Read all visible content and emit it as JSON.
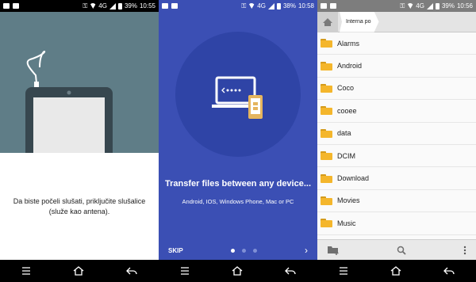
{
  "panels": [
    {
      "status": {
        "time": "10:55",
        "battery": "39%",
        "network": "4G"
      },
      "message": "Da biste počeli slušati, priključite slušalice (služe kao antena)."
    },
    {
      "status": {
        "time": "10:58",
        "battery": "38%",
        "network": "4G"
      },
      "title": "Transfer files between any device...",
      "subtitle": "Android, IOS, Windows Phone, Mac or PC",
      "skip_label": "SKIP",
      "page_indicator": {
        "pages": 3,
        "current": 1
      }
    },
    {
      "status": {
        "time": "10:56",
        "battery": "39%",
        "network": "4G"
      },
      "breadcrumb": "Interna po",
      "folders": [
        "Alarms",
        "Android",
        "Coco",
        "cooee",
        "data",
        "DCIM",
        "Download",
        "Movies",
        "Music"
      ]
    }
  ],
  "icons": {
    "home": "home-icon",
    "back": "back-arrow-icon",
    "menu": "menu-lines-icon",
    "new_folder": "new-folder-icon",
    "search": "search-icon",
    "overflow": "overflow-menu-icon"
  },
  "colors": {
    "panel1_hero": "#5f7d87",
    "panel2_bg": "#3b4fb4",
    "folder": "#f4b62c"
  }
}
